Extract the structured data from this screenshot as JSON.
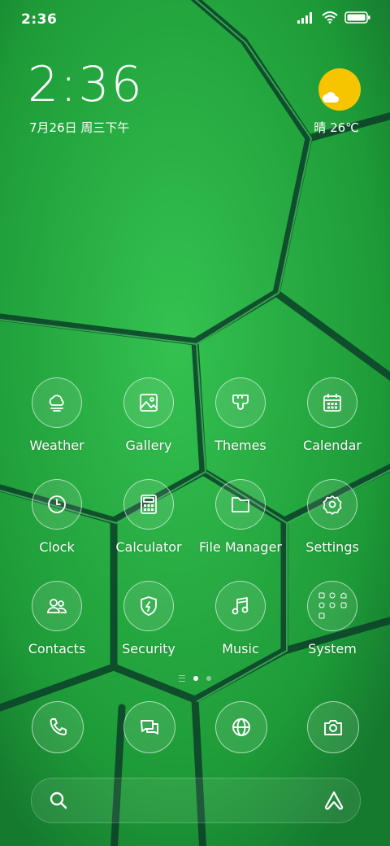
{
  "status_bar": {
    "time": "2:36",
    "icons": [
      "signal-icon",
      "wifi-icon",
      "battery-icon"
    ]
  },
  "clock_widget": {
    "time": "2:36",
    "date": "7月26日 周三下午"
  },
  "weather_widget": {
    "condition": "晴",
    "temperature": "26℃",
    "text": "晴 26℃",
    "icon": "sun-cloud-icon"
  },
  "apps": [
    {
      "label": "Weather",
      "icon": "cloud-sun-icon"
    },
    {
      "label": "Gallery",
      "icon": "image-icon"
    },
    {
      "label": "Themes",
      "icon": "paintbrush-icon"
    },
    {
      "label": "Calendar",
      "icon": "calendar-icon"
    },
    {
      "label": "Clock",
      "icon": "clock-icon"
    },
    {
      "label": "Calculator",
      "icon": "calculator-icon"
    },
    {
      "label": "File Manager",
      "icon": "folder-icon"
    },
    {
      "label": "Settings",
      "icon": "gear-icon"
    },
    {
      "label": "Contacts",
      "icon": "contacts-icon"
    },
    {
      "label": "Security",
      "icon": "shield-icon"
    },
    {
      "label": "Music",
      "icon": "music-icon"
    },
    {
      "label": "System",
      "icon": "folder-grid-icon"
    }
  ],
  "page_indicator": {
    "pages": 2,
    "current": 1
  },
  "dock": [
    {
      "icon": "phone-icon"
    },
    {
      "icon": "messages-icon"
    },
    {
      "icon": "browser-icon"
    },
    {
      "icon": "camera-icon"
    }
  ],
  "search_bar": {
    "left_icon": "search-icon",
    "right_icon": "assistant-icon"
  },
  "colors": {
    "wallpaper_green": "#1f9a3a",
    "wallpaper_light": "#2fbf4a",
    "wallpaper_dark": "#0b3b2a",
    "sun": "#f6c500"
  }
}
